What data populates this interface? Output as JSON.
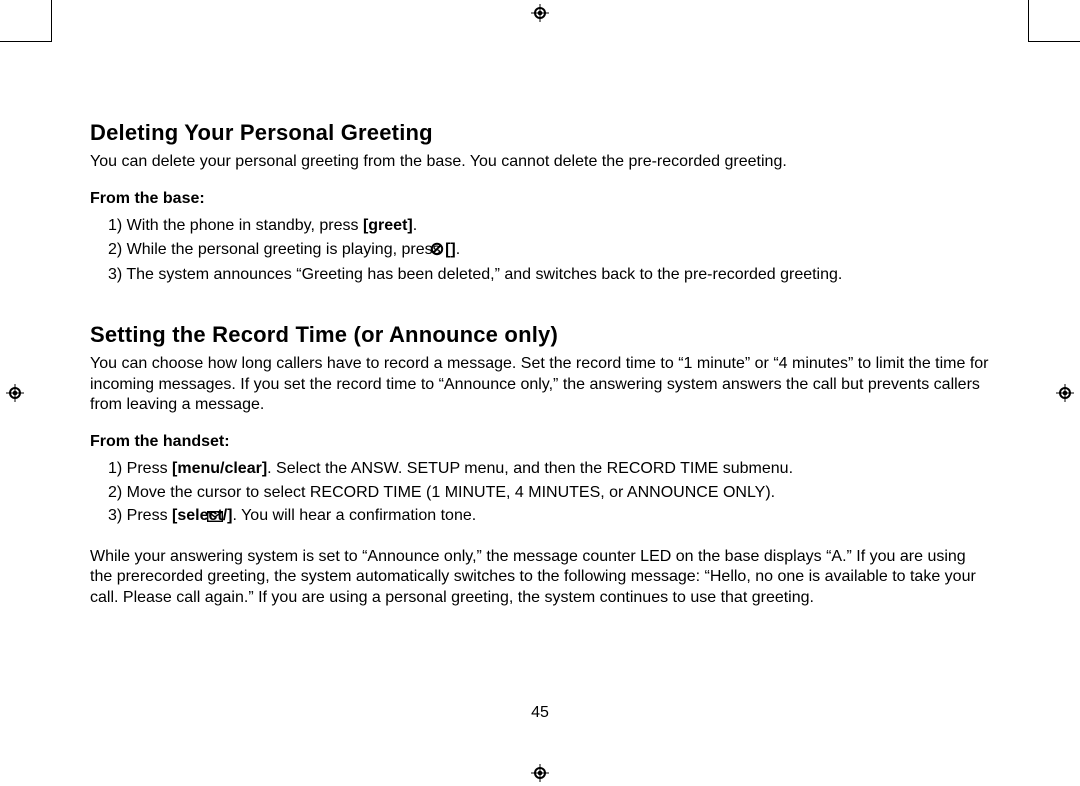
{
  "page_number": "45",
  "section1": {
    "heading": "Deleting Your Personal Greeting",
    "intro": "You can delete your personal greeting from the base. You cannot delete the pre-recorded greeting.",
    "sub": "From the base:",
    "step1_a": "1) With the phone in standby, press ",
    "step1_b": "[greet]",
    "step1_c": ".",
    "step2_a": "2) While the personal greeting is playing, press ",
    "step2_b": "[",
    "step2_c": "]",
    "step2_d": ".",
    "step3": "3) The system announces “Greeting has been deleted,” and switches back to the pre-recorded greeting."
  },
  "section2": {
    "heading": "Setting the Record Time (or Announce only)",
    "intro": "You can choose how long callers have to record a message. Set the record time to “1 minute” or “4 minutes” to limit the time for incoming messages. If you set the record time to “Announce only,” the answering system answers the call but prevents callers from leaving a message.",
    "sub": "From the handset:",
    "step1_a": "1) Press ",
    "step1_b": "[menu/clear]",
    "step1_c": ".  Select the ANSW. SETUP menu, and then the RECORD TIME submenu.",
    "step2": "2) Move the cursor to select RECORD TIME (1 MINUTE, 4 MINUTES, or ANNOUNCE ONLY).",
    "step3_a": "3) Press ",
    "step3_b": "[select/",
    "step3_c": "]",
    "step3_d": ". You will hear a confirmation tone.",
    "note": "While your answering system is set to “Announce only,” the message counter LED on the base displays “A.” If you are using the prerecorded greeting, the system automatically switches to the following message: “Hello, no one is available to take your call. Please call again.” If you are using a personal greeting, the system continues to use that greeting."
  }
}
